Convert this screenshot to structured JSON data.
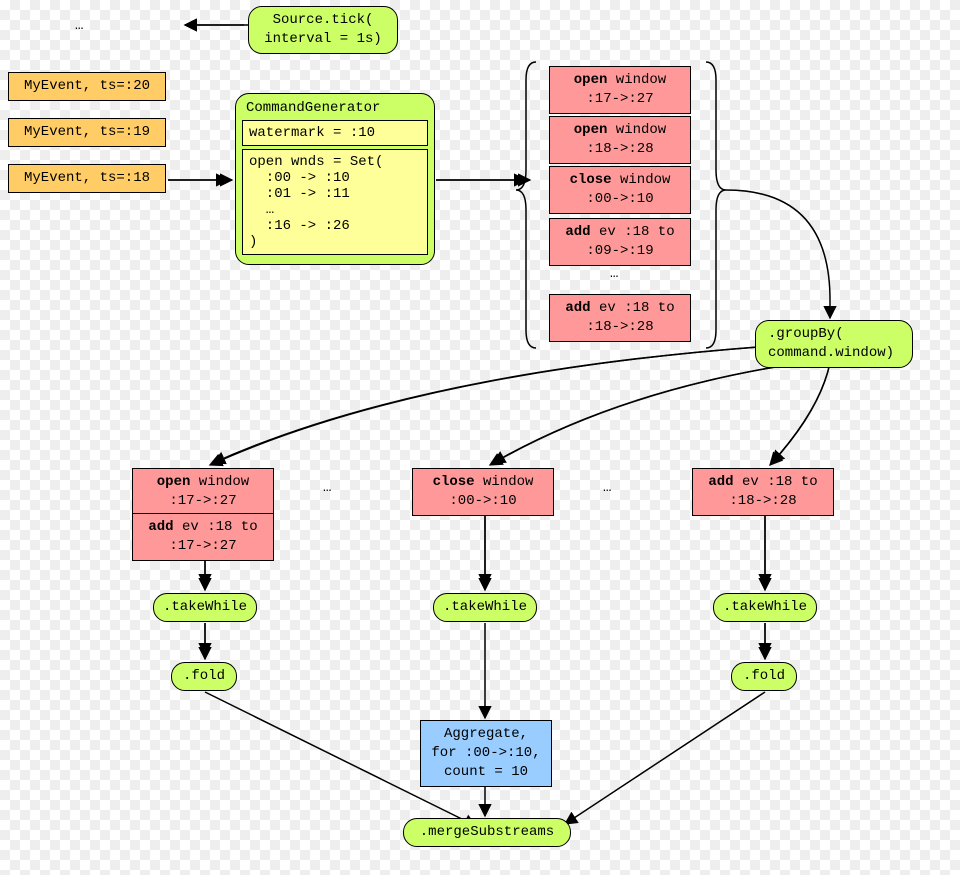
{
  "ellipsis1": "…",
  "source": {
    "line1": "Source.tick(",
    "line2": "interval = 1s)"
  },
  "events": {
    "e1": "MyEvent, ts=:20",
    "e2": "MyEvent, ts=:19",
    "e3": "MyEvent, ts=:18"
  },
  "cmdgen": {
    "title": "CommandGenerator",
    "watermark": "watermark = :10",
    "wnds": "open wnds = Set(\n  :00 -> :10\n  :01 -> :11\n  …\n  :16 -> :26\n)"
  },
  "cmds": {
    "c1": {
      "a": "open",
      "b": " window",
      "c": ":17->:27"
    },
    "c2": {
      "a": "open",
      "b": " window",
      "c": ":18->:28"
    },
    "c3": {
      "a": "close",
      "b": " window",
      "c": ":00->:10"
    },
    "c4": {
      "a": "add",
      "b": " ev :18 to",
      "c": ":09->:19"
    },
    "c5": {
      "a": "add",
      "b": " ev :18 to",
      "c": ":18->:28"
    }
  },
  "ellipsisMid": "…",
  "groupby": {
    "line1": ".groupBy(",
    "line2": "command.window)"
  },
  "branches": {
    "b1_c1": {
      "a": "open",
      "b": " window",
      "c": ":17->:27"
    },
    "b1_c2": {
      "a": "add",
      "b": " ev :18 to",
      "c": ":17->:27"
    },
    "b2_c1": {
      "a": "close",
      "b": " window",
      "c": ":00->:10"
    },
    "b3_c1": {
      "a": "add",
      "b": " ev :18 to",
      "c": ":18->:28"
    }
  },
  "ellipsisB1": "…",
  "ellipsisB2": "…",
  "takewhile": ".takeWhile",
  "fold": ".fold",
  "aggregate": {
    "l1": "Aggregate,",
    "l2": "for :00->:10,",
    "l3": "count = 10"
  },
  "merge": ".mergeSubstreams"
}
